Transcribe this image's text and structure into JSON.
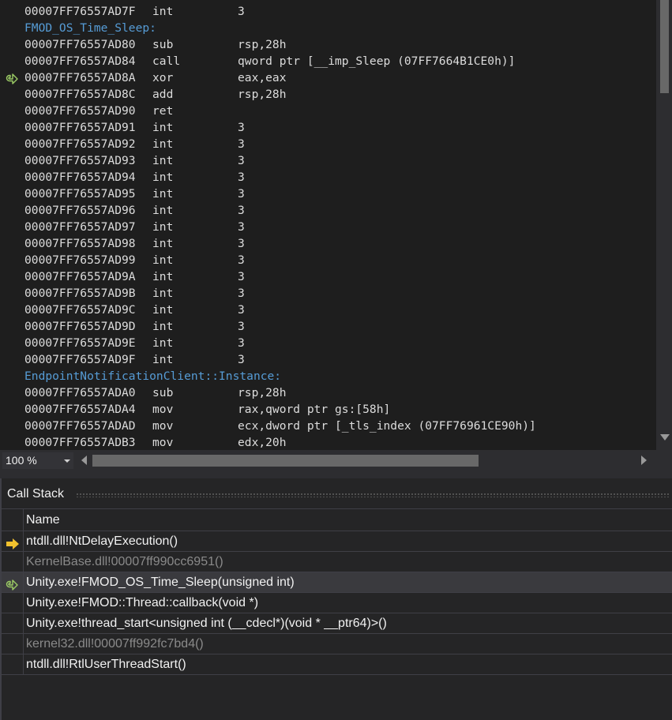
{
  "disassembly": {
    "lines": [
      {
        "type": "code",
        "addr": "00007FF76557AD7F",
        "mn": "int",
        "op": "3"
      },
      {
        "type": "label",
        "text": "FMOD_OS_Time_Sleep:"
      },
      {
        "type": "code",
        "addr": "00007FF76557AD80",
        "mn": "sub",
        "op": "rsp,28h"
      },
      {
        "type": "code",
        "addr": "00007FF76557AD84",
        "mn": "call",
        "op": "qword ptr [__imp_Sleep (07FF7664B1CE0h)]"
      },
      {
        "type": "code",
        "addr": "00007FF76557AD8A",
        "mn": "xor",
        "op": "eax,eax",
        "marker": "return-arrow-icon"
      },
      {
        "type": "code",
        "addr": "00007FF76557AD8C",
        "mn": "add",
        "op": "rsp,28h"
      },
      {
        "type": "code",
        "addr": "00007FF76557AD90",
        "mn": "ret",
        "op": ""
      },
      {
        "type": "code",
        "addr": "00007FF76557AD91",
        "mn": "int",
        "op": "3"
      },
      {
        "type": "code",
        "addr": "00007FF76557AD92",
        "mn": "int",
        "op": "3"
      },
      {
        "type": "code",
        "addr": "00007FF76557AD93",
        "mn": "int",
        "op": "3"
      },
      {
        "type": "code",
        "addr": "00007FF76557AD94",
        "mn": "int",
        "op": "3"
      },
      {
        "type": "code",
        "addr": "00007FF76557AD95",
        "mn": "int",
        "op": "3"
      },
      {
        "type": "code",
        "addr": "00007FF76557AD96",
        "mn": "int",
        "op": "3"
      },
      {
        "type": "code",
        "addr": "00007FF76557AD97",
        "mn": "int",
        "op": "3"
      },
      {
        "type": "code",
        "addr": "00007FF76557AD98",
        "mn": "int",
        "op": "3"
      },
      {
        "type": "code",
        "addr": "00007FF76557AD99",
        "mn": "int",
        "op": "3"
      },
      {
        "type": "code",
        "addr": "00007FF76557AD9A",
        "mn": "int",
        "op": "3"
      },
      {
        "type": "code",
        "addr": "00007FF76557AD9B",
        "mn": "int",
        "op": "3"
      },
      {
        "type": "code",
        "addr": "00007FF76557AD9C",
        "mn": "int",
        "op": "3"
      },
      {
        "type": "code",
        "addr": "00007FF76557AD9D",
        "mn": "int",
        "op": "3"
      },
      {
        "type": "code",
        "addr": "00007FF76557AD9E",
        "mn": "int",
        "op": "3"
      },
      {
        "type": "code",
        "addr": "00007FF76557AD9F",
        "mn": "int",
        "op": "3"
      },
      {
        "type": "label",
        "text": "EndpointNotificationClient::Instance:"
      },
      {
        "type": "code",
        "addr": "00007FF76557ADA0",
        "mn": "sub",
        "op": "rsp,28h"
      },
      {
        "type": "code",
        "addr": "00007FF76557ADA4",
        "mn": "mov",
        "op": "rax,qword ptr gs:[58h]"
      },
      {
        "type": "code",
        "addr": "00007FF76557ADAD",
        "mn": "mov",
        "op": "ecx,dword ptr [_tls_index (07FF76961CE90h)]"
      },
      {
        "type": "code",
        "addr": "00007FF76557ADB3",
        "mn": "mov",
        "op": "edx,20h"
      }
    ]
  },
  "zoom": {
    "value": "100 %"
  },
  "callstack": {
    "title": "Call Stack",
    "column_name": "Name",
    "rows": [
      {
        "text": "ntdll.dll!NtDelayExecution()",
        "style": "normal",
        "icon": "current-frame-arrow-icon"
      },
      {
        "text": "KernelBase.dll!00007ff990cc6951()",
        "style": "dim",
        "icon": ""
      },
      {
        "text": "Unity.exe!FMOD_OS_Time_Sleep(unsigned int)",
        "style": "selected",
        "icon": "return-arrow-icon"
      },
      {
        "text": "Unity.exe!FMOD::Thread::callback(void *)",
        "style": "normal",
        "icon": ""
      },
      {
        "text": "Unity.exe!thread_start<unsigned int (__cdecl*)(void * __ptr64)>()",
        "style": "normal",
        "icon": ""
      },
      {
        "text": "kernel32.dll!00007ff992fc7bd4()",
        "style": "dim",
        "icon": ""
      },
      {
        "text": "ntdll.dll!RtlUserThreadStart()",
        "style": "normal",
        "icon": ""
      }
    ]
  },
  "colors": {
    "label": "#569cd6",
    "current_arrow": "#f2c12e",
    "return_arrow": "#9ccc65"
  }
}
